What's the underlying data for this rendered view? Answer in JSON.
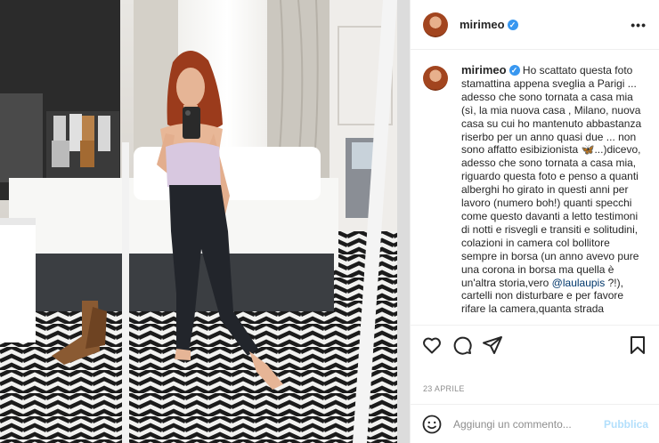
{
  "post": {
    "username": "mirimeo",
    "more_glyph": "•••",
    "verified_glyph": "✓",
    "caption_text": " Ho scattato questa foto stamattina appena sveglia a Parigi ... adesso che sono tornata a casa mia (sì, la mia nuova casa , Milano, nuova casa su cui ho mantenuto abbastanza riserbo per un anno quasi due ... non sono affatto esibizionista 🦋...)dicevo, adesso che sono tornata a casa mia, riguardo questa foto e penso a quanti alberghi ho girato in questi anni per lavoro (numero boh!) quanti specchi come questo davanti a letto testimoni di notti e risvegli e transiti e solitudini, colazioni in camera col bollitore sempre in borsa (un anno avevo pure una corona in borsa ma quella è un'altra storia,vero ",
    "mention": "@laulaupis",
    "caption_tail": " ?!), cartelli non disturbare e per favore rifare la camera,quanta strada",
    "date": "23 APRILE",
    "comment_placeholder": "Aggiungi un commento...",
    "post_button": "Pubblica"
  },
  "icons": {
    "verified": "verified-badge-icon",
    "more": "more-options-icon",
    "like": "heart-icon",
    "comment": "comment-bubble-icon",
    "share": "paper-plane-icon",
    "save": "bookmark-icon",
    "emoji": "smiley-icon"
  },
  "colors": {
    "verified": "#3897f0",
    "mention": "#00376b",
    "post_button_disabled": "#b2dffc",
    "muted_text": "#8e8e8e"
  }
}
